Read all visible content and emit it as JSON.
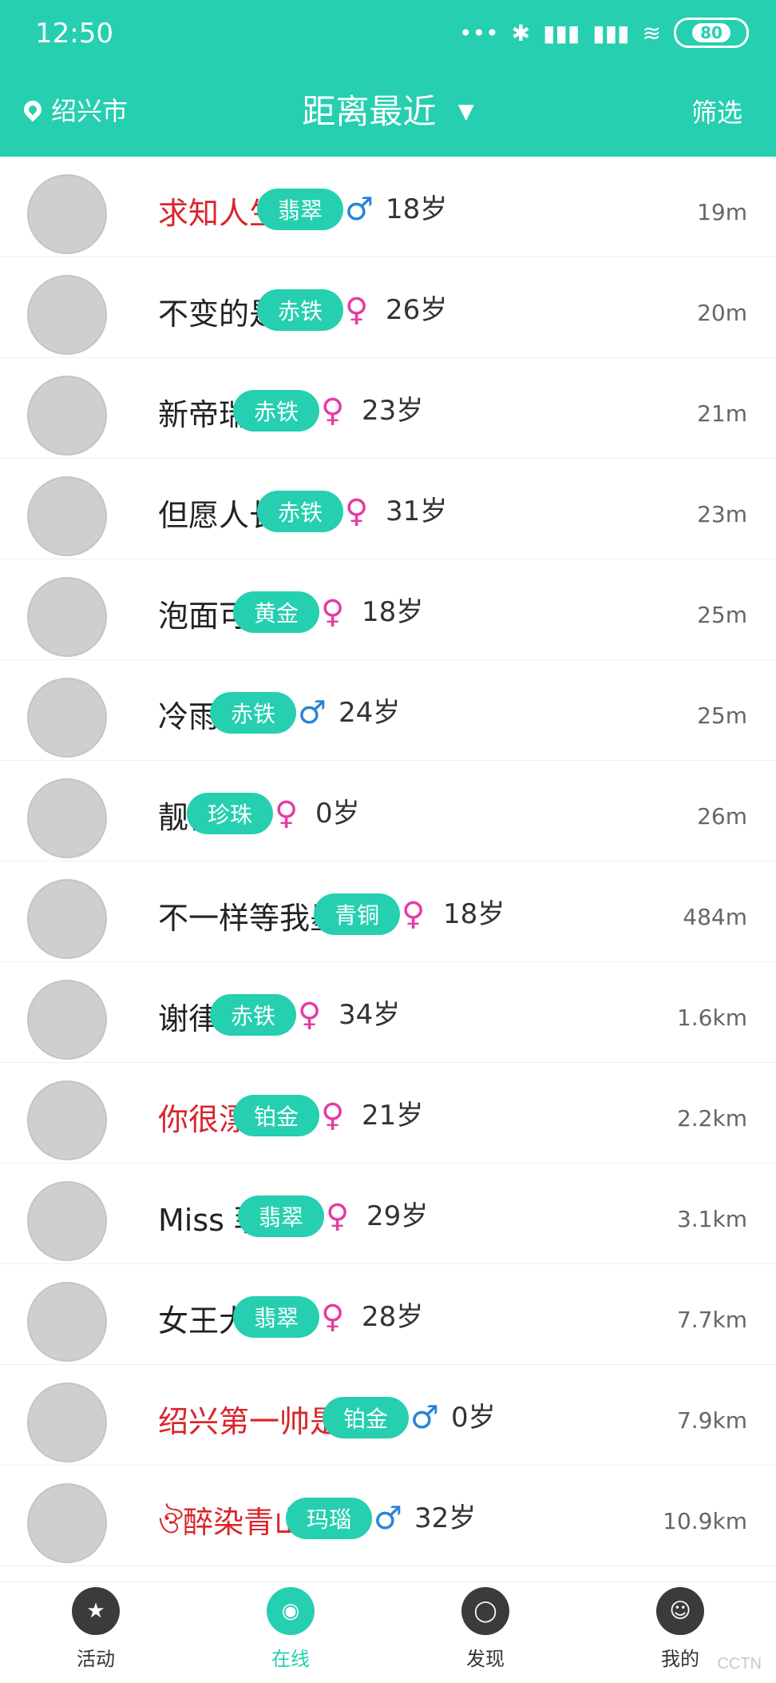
{
  "status_bar": {
    "time": "12:50",
    "battery": "80",
    "icons": [
      "signal-dots-icon",
      "bluetooth-icon",
      "signal-bars-icon",
      "signal-bars-icon",
      "wifi-icon"
    ]
  },
  "header": {
    "location": "绍兴市",
    "title": "距离最近",
    "filter": "筛选"
  },
  "users": [
    {
      "name": "求知人生鱼",
      "name_color": "red",
      "tag": "翡翠",
      "gender": "male",
      "age": "18岁",
      "distance": "19m"
    },
    {
      "name": "不变的是你",
      "name_color": "dark",
      "tag": "赤铁",
      "gender": "female",
      "age": "26岁",
      "distance": "20m"
    },
    {
      "name": "新帝瑞拉",
      "name_color": "dark",
      "tag": "赤铁",
      "gender": "female",
      "age": "23岁",
      "distance": "21m"
    },
    {
      "name": "但愿人长久",
      "name_color": "dark",
      "tag": "赤铁",
      "gender": "female",
      "age": "31岁",
      "distance": "23m"
    },
    {
      "name": "泡面可爱",
      "name_color": "dark",
      "tag": "黄金",
      "gender": "female",
      "age": "18岁",
      "distance": "25m"
    },
    {
      "name": "冷雨夜",
      "name_color": "dark",
      "tag": "赤铁",
      "gender": "male",
      "age": "24岁",
      "distance": "25m"
    },
    {
      "name": "靓仔",
      "name_color": "dark",
      "tag": "珍珠",
      "gender": "female",
      "age": "0岁",
      "distance": "26m"
    },
    {
      "name": "不一样等我墨...",
      "name_color": "dark",
      "tag": "青铜",
      "gender": "female",
      "age": "18岁",
      "distance": "484m"
    },
    {
      "name": "谢律师",
      "name_color": "dark",
      "tag": "赤铁",
      "gender": "female",
      "age": "34岁",
      "distance": "1.6km"
    },
    {
      "name": "你很漂亮",
      "name_color": "red",
      "tag": "铂金",
      "gender": "female",
      "age": "21岁",
      "distance": "2.2km"
    },
    {
      "name": "Miss 菲。",
      "name_color": "dark",
      "tag": "翡翠",
      "gender": "female",
      "age": "29岁",
      "distance": "3.1km"
    },
    {
      "name": "女王大人",
      "name_color": "dark",
      "tag": "翡翠",
      "gender": "female",
      "age": "28岁",
      "distance": "7.7km"
    },
    {
      "name": "绍兴第一帅是我...",
      "name_color": "red",
      "tag": "铂金",
      "gender": "male",
      "age": "0岁",
      "distance": "7.9km"
    },
    {
      "name": "ঔ醉染青山ঔ",
      "name_color": "red",
      "tag": "玛瑙",
      "gender": "male",
      "age": "32岁",
      "distance": "10.9km"
    }
  ],
  "bottom_nav": [
    {
      "label": "活动",
      "icon": "star-box-icon",
      "active": false
    },
    {
      "label": "在线",
      "icon": "location-pin-icon",
      "active": true
    },
    {
      "label": "发现",
      "icon": "planet-icon",
      "active": false
    },
    {
      "label": "我的",
      "icon": "profile-icon",
      "active": false
    }
  ],
  "colors": {
    "accent": "#25cfb0",
    "male": "#2a84d6",
    "female": "#e63aa2",
    "name_red": "#d9252b"
  },
  "watermark": "CCTN"
}
